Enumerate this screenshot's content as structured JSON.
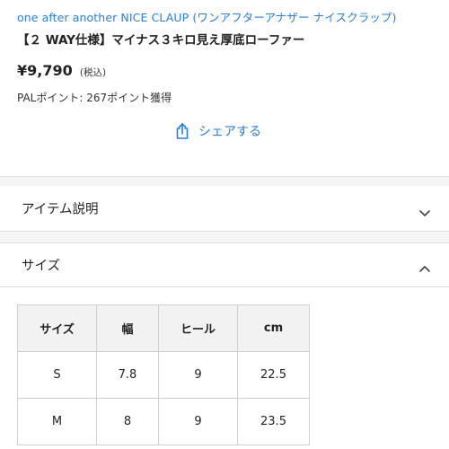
{
  "product": {
    "brand": "one after another NICE CLAUP (ワンアフターアナザー ナイスクラップ)",
    "title": "【２ WAY仕様】マイナス３キロ見え厚底ローファー",
    "price": "¥9,790",
    "tax_note": "(税込)",
    "points": "PALポイント: 267ポイント獲得",
    "share_label": "シェアする"
  },
  "accordions": {
    "item_description": "アイテム説明",
    "size": "サイズ"
  },
  "size_table": {
    "headers": [
      "サイズ",
      "幅",
      "ヒール",
      "cm"
    ],
    "rows": [
      [
        "S",
        "7.8",
        "9",
        "22.5"
      ],
      [
        "M",
        "8",
        "9",
        "23.5"
      ]
    ]
  },
  "icons": {
    "share": "share-icon",
    "expand": "chevron-down-icon",
    "collapse": "chevron-up-icon"
  },
  "colors": {
    "accent": "#2a7fd6",
    "text": "#222222",
    "table_header_bg": "#f2f2f2"
  }
}
